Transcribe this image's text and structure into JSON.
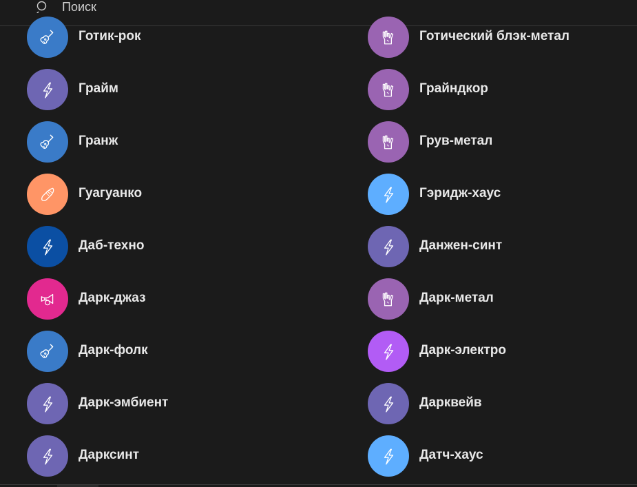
{
  "search": {
    "placeholder": "Поиск",
    "icon": "search-icon"
  },
  "colors": {
    "background": "#1b1b1b",
    "blue": "#3a7bc8",
    "violet": "#6e66b3",
    "orange": "#ff9566",
    "navy": "#0b4fa3",
    "magenta": "#e2298f",
    "purple_rock": "#9a64b2",
    "sky": "#5eaeff",
    "bright_violet": "#b25cf5"
  },
  "genres": [
    {
      "label": "Готик-рок",
      "icon": "guitar",
      "color": "#3a7bc8"
    },
    {
      "label": "Готический блэк-метал",
      "icon": "rock-hand",
      "color": "#9a64b2"
    },
    {
      "label": "Грайм",
      "icon": "lightning",
      "color": "#6e66b3"
    },
    {
      "label": "Грайндкор",
      "icon": "rock-hand",
      "color": "#9a64b2"
    },
    {
      "label": "Гранж",
      "icon": "guitar",
      "color": "#3a7bc8"
    },
    {
      "label": "Грув-метал",
      "icon": "rock-hand",
      "color": "#9a64b2"
    },
    {
      "label": "Гуагуанко",
      "icon": "maraca",
      "color": "#ff9566"
    },
    {
      "label": "Гэридж-хаус",
      "icon": "lightning",
      "color": "#5eaeff"
    },
    {
      "label": "Даб-техно",
      "icon": "lightning",
      "color": "#0b4fa3"
    },
    {
      "label": "Данжен-синт",
      "icon": "lightning",
      "color": "#6e66b3"
    },
    {
      "label": "Дарк-джаз",
      "icon": "trumpet",
      "color": "#e2298f"
    },
    {
      "label": "Дарк-метал",
      "icon": "rock-hand",
      "color": "#9a64b2"
    },
    {
      "label": "Дарк-фолк",
      "icon": "guitar",
      "color": "#3a7bc8"
    },
    {
      "label": "Дарк-электро",
      "icon": "lightning",
      "color": "#b25cf5"
    },
    {
      "label": "Дарк-эмбиент",
      "icon": "lightning",
      "color": "#6e66b3"
    },
    {
      "label": "Дарквейв",
      "icon": "lightning",
      "color": "#6e66b3"
    },
    {
      "label": "Дарксинт",
      "icon": "lightning",
      "color": "#6e66b3"
    },
    {
      "label": "Датч-хаус",
      "icon": "lightning",
      "color": "#5eaeff"
    }
  ]
}
